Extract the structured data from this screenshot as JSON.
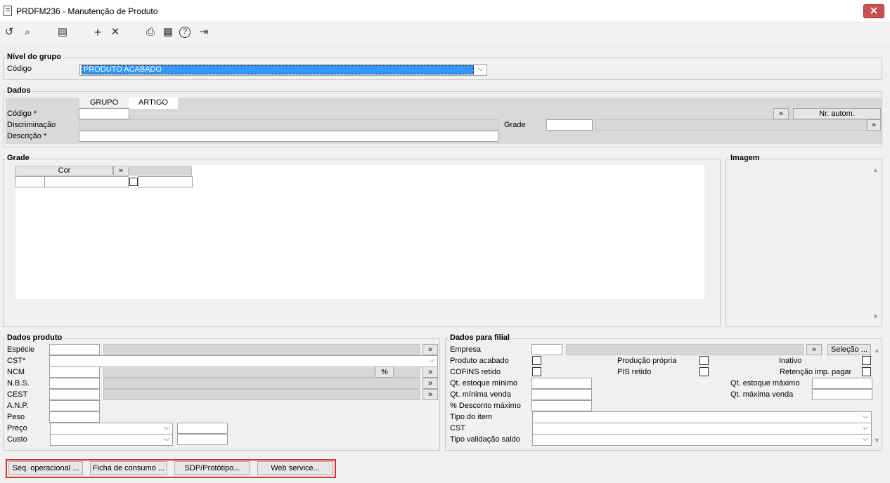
{
  "window": {
    "title": "PRDFM236 - Manutenção de Produto",
    "close": "✕"
  },
  "toolbar": {
    "undo": "↺",
    "search": "⌕",
    "save": "▤",
    "add": "+",
    "delete": "✕",
    "print": "⎙",
    "calendar": "▦",
    "help": "?",
    "exit": "⇥"
  },
  "nivel": {
    "legend": "Nível do grupo",
    "codigo_label": "Código",
    "codigo_value": "PRODUTO ACABADO"
  },
  "dados": {
    "legend": "Dados",
    "tab_grupo": "GRUPO",
    "tab_artigo": "ARTIGO",
    "codigo_label": "Código *",
    "discriminacao_label": "Discriminação",
    "descricao_label": "Descrição *",
    "grade_label": "Grade",
    "nr_autom": "Nr. autom.",
    "lookup": "»"
  },
  "grade": {
    "legend": "Grade",
    "col_cor": "Cor",
    "lookup": "»"
  },
  "imagem": {
    "legend": "Imagem"
  },
  "produto": {
    "legend": "Dados produto",
    "especie": "Espécie",
    "cst": "CST*",
    "ncm": "NCM",
    "nbs": "N.B.S.",
    "cest": "CEST",
    "anp": "A.N.P.",
    "peso": "Peso",
    "preco": "Preço",
    "custo": "Custo",
    "pct": "%",
    "lookup": "»"
  },
  "filial": {
    "legend": "Dados para filial",
    "empresa": "Empresa",
    "selecao": "Seleção ...",
    "lookup": "»",
    "produto_acabado": "Produto acabado",
    "producao_propria": "Produção própria",
    "inativo": "Inativo",
    "cofins_retido": "COFINS retido",
    "pis_retido": "PIS retido",
    "retencao": "Retenção imp. pagar",
    "qt_est_min": "Qt. estoque mínimo",
    "qt_est_max": "Qt. estoque máximo",
    "qt_min_venda": "Qt. mínima venda",
    "qt_max_venda": "Qt. máxima venda",
    "pct_desc": "% Desconto máximo",
    "tipo_item": "Tipo do item",
    "cst": "CST",
    "tipo_valid": "Tipo validação saldo"
  },
  "bottom": {
    "seq": "Seq. operacional ...",
    "ficha": "Ficha de consumo ...",
    "sdp": "SDP/Protótipo...",
    "web": "Web service..."
  },
  "colors": {
    "selection": "#3399ff",
    "highlight_border": "#e03030"
  }
}
